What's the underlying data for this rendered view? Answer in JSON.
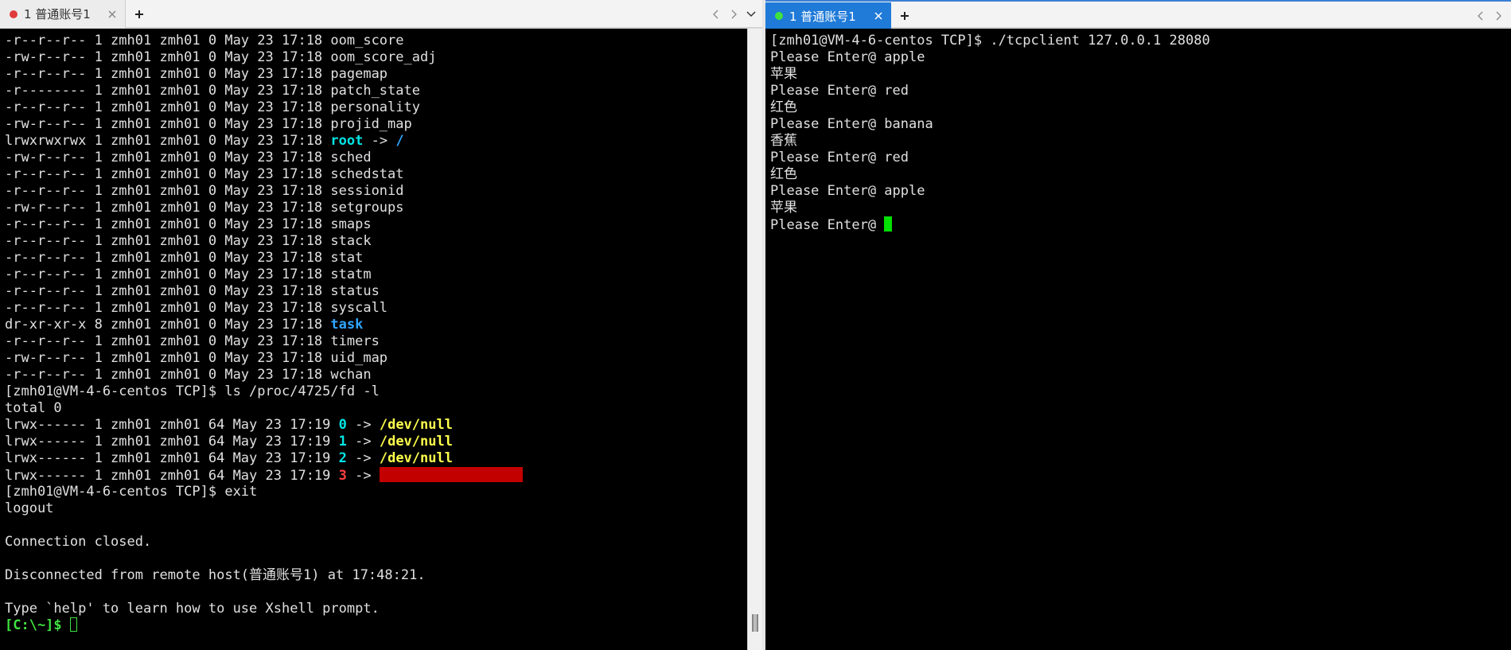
{
  "left": {
    "tab": {
      "label": "1 普通账号1",
      "status_color": "#e03b3b"
    },
    "lines": [
      [
        {
          "t": "-r--r--r-- 1 zmh01 zmh01 0 May 23 17:18 oom_score"
        }
      ],
      [
        {
          "t": "-rw-r--r-- 1 zmh01 zmh01 0 May 23 17:18 oom_score_adj"
        }
      ],
      [
        {
          "t": "-r--r--r-- 1 zmh01 zmh01 0 May 23 17:18 pagemap"
        }
      ],
      [
        {
          "t": "-r-------- 1 zmh01 zmh01 0 May 23 17:18 patch_state"
        }
      ],
      [
        {
          "t": "-r--r--r-- 1 zmh01 zmh01 0 May 23 17:18 personality"
        }
      ],
      [
        {
          "t": "-rw-r--r-- 1 zmh01 zmh01 0 May 23 17:18 projid_map"
        }
      ],
      [
        {
          "t": "lrwxrwxrwx 1 zmh01 zmh01 0 May 23 17:18 "
        },
        {
          "t": "root",
          "c": "cyan"
        },
        {
          "t": " -> "
        },
        {
          "t": "/",
          "c": "blue"
        }
      ],
      [
        {
          "t": "-rw-r--r-- 1 zmh01 zmh01 0 May 23 17:18 sched"
        }
      ],
      [
        {
          "t": "-r--r--r-- 1 zmh01 zmh01 0 May 23 17:18 schedstat"
        }
      ],
      [
        {
          "t": "-r--r--r-- 1 zmh01 zmh01 0 May 23 17:18 sessionid"
        }
      ],
      [
        {
          "t": "-rw-r--r-- 1 zmh01 zmh01 0 May 23 17:18 setgroups"
        }
      ],
      [
        {
          "t": "-r--r--r-- 1 zmh01 zmh01 0 May 23 17:18 smaps"
        }
      ],
      [
        {
          "t": "-r--r--r-- 1 zmh01 zmh01 0 May 23 17:18 stack"
        }
      ],
      [
        {
          "t": "-r--r--r-- 1 zmh01 zmh01 0 May 23 17:18 stat"
        }
      ],
      [
        {
          "t": "-r--r--r-- 1 zmh01 zmh01 0 May 23 17:18 statm"
        }
      ],
      [
        {
          "t": "-r--r--r-- 1 zmh01 zmh01 0 May 23 17:18 status"
        }
      ],
      [
        {
          "t": "-r--r--r-- 1 zmh01 zmh01 0 May 23 17:18 syscall"
        }
      ],
      [
        {
          "t": "dr-xr-xr-x 8 zmh01 zmh01 0 May 23 17:18 "
        },
        {
          "t": "task",
          "c": "blue"
        }
      ],
      [
        {
          "t": "-r--r--r-- 1 zmh01 zmh01 0 May 23 17:18 timers"
        }
      ],
      [
        {
          "t": "-rw-r--r-- 1 zmh01 zmh01 0 May 23 17:18 uid_map"
        }
      ],
      [
        {
          "t": "-r--r--r-- 1 zmh01 zmh01 0 May 23 17:18 wchan"
        }
      ],
      [
        {
          "t": "[zmh01@VM-4-6-centos TCP]$ ls /proc/4725/fd -l"
        }
      ],
      [
        {
          "t": "total 0"
        }
      ],
      [
        {
          "t": "lrwx------ 1 zmh01 zmh01 64 May 23 17:19 "
        },
        {
          "t": "0",
          "c": "cyan"
        },
        {
          "t": " -> "
        },
        {
          "t": "/dev/null",
          "c": "yellow"
        }
      ],
      [
        {
          "t": "lrwx------ 1 zmh01 zmh01 64 May 23 17:19 "
        },
        {
          "t": "1",
          "c": "cyan"
        },
        {
          "t": " -> "
        },
        {
          "t": "/dev/null",
          "c": "yellow"
        }
      ],
      [
        {
          "t": "lrwx------ 1 zmh01 zmh01 64 May 23 17:19 "
        },
        {
          "t": "2",
          "c": "cyan"
        },
        {
          "t": " -> "
        },
        {
          "t": "/dev/null",
          "c": "yellow"
        }
      ],
      [
        {
          "t": "lrwx------ 1 zmh01 zmh01 64 May 23 17:19 "
        },
        {
          "t": "3",
          "c": "red"
        },
        {
          "t": " -> "
        },
        {
          "redacted": true
        }
      ],
      [
        {
          "t": "[zmh01@VM-4-6-centos TCP]$ exit"
        }
      ],
      [
        {
          "t": "logout"
        }
      ],
      [
        {
          "t": ""
        }
      ],
      [
        {
          "t": "Connection closed."
        }
      ],
      [
        {
          "t": ""
        }
      ],
      [
        {
          "t": "Disconnected from remote host(普通账号1) at 17:48:21."
        }
      ],
      [
        {
          "t": ""
        }
      ],
      [
        {
          "t": "Type `help' to learn how to use Xshell prompt."
        }
      ],
      [
        {
          "t": "[C:\\~]$ ",
          "c": "green"
        },
        {
          "cursor": "hollow"
        }
      ]
    ]
  },
  "right": {
    "tab": {
      "label": "1 普通账号1",
      "status_color": "#3fe23f"
    },
    "lines": [
      [
        {
          "t": "[zmh01@VM-4-6-centos TCP]$ ./tcpclient 127.0.0.1 28080"
        }
      ],
      [
        {
          "t": "Please Enter@ apple"
        }
      ],
      [
        {
          "t": "苹果"
        }
      ],
      [
        {
          "t": "Please Enter@ red"
        }
      ],
      [
        {
          "t": "红色"
        }
      ],
      [
        {
          "t": "Please Enter@ banana"
        }
      ],
      [
        {
          "t": "香蕉"
        }
      ],
      [
        {
          "t": "Please Enter@ red"
        }
      ],
      [
        {
          "t": "红色"
        }
      ],
      [
        {
          "t": "Please Enter@ apple"
        }
      ],
      [
        {
          "t": "苹果"
        }
      ],
      [
        {
          "t": "Please Enter@ "
        },
        {
          "cursor": "solid"
        }
      ]
    ]
  },
  "icons": {
    "close": "close-icon",
    "add": "plus-icon",
    "prev": "chevron-left-icon",
    "next": "chevron-right-icon",
    "menu": "chevron-down-icon"
  },
  "colors": {
    "accent": "#1f7ad8",
    "terminal_bg": "#000000",
    "terminal_fg": "#e0e0e0",
    "redacted": "#c30000"
  }
}
